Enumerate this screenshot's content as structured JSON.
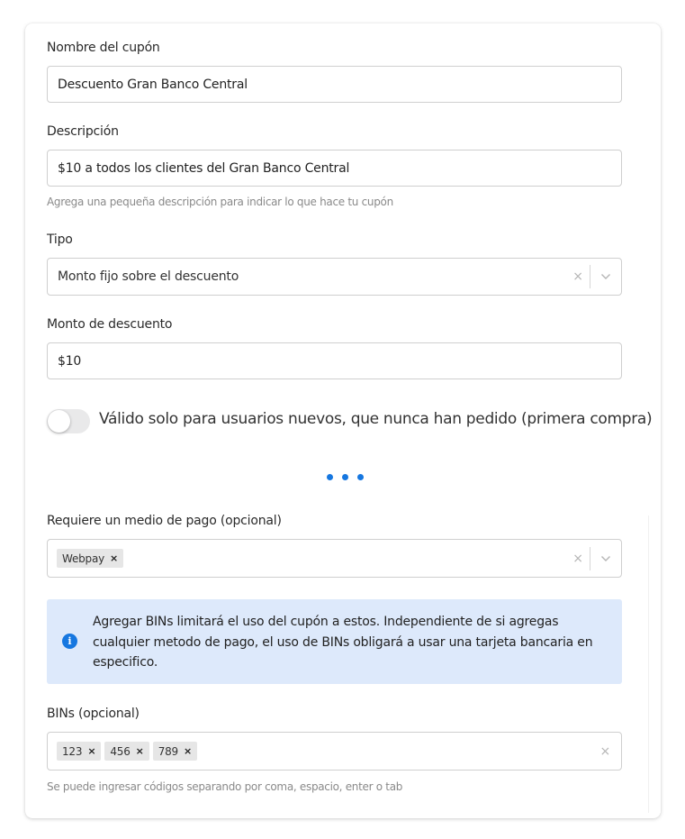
{
  "coupon_name": {
    "label": "Nombre del cupón",
    "value": "Descuento Gran Banco Central"
  },
  "description": {
    "label": "Descripción",
    "value": "$10 a todos los clientes del Gran Banco Central",
    "hint": "Agrega una pequeña descripción para indicar lo que hace tu cupón"
  },
  "type": {
    "label": "Tipo",
    "value": "Monto fijo sobre el descuento",
    "clear": "×"
  },
  "discount_amount": {
    "label": "Monto de descuento",
    "value": "$10"
  },
  "new_users_toggle": {
    "label": "Válido solo para usuarios nuevos, que nunca han pedido (primera compra)",
    "checked": false
  },
  "payment_method": {
    "label": "Requiere un medio de pago (opcional)",
    "chips": [
      "Webpay"
    ],
    "clear": "×"
  },
  "info_box": {
    "icon": "info-icon",
    "text": "Agregar BINs limitará el uso del cupón a estos. Independiente de si agregas cualquier metodo de pago, el uso de BINs obligará a usar una tarjeta bancaria en especifico."
  },
  "bins": {
    "label": "BINs (opcional)",
    "chips": [
      "123",
      "456",
      "789"
    ],
    "clear": "×",
    "hint": "Se puede ingresar códigos separando por coma, espacio, enter o tab"
  },
  "chip_remove": "×",
  "colors": {
    "accent": "#1677e0",
    "info_bg": "#dde9fb",
    "chip_bg": "#e6e6e6"
  }
}
